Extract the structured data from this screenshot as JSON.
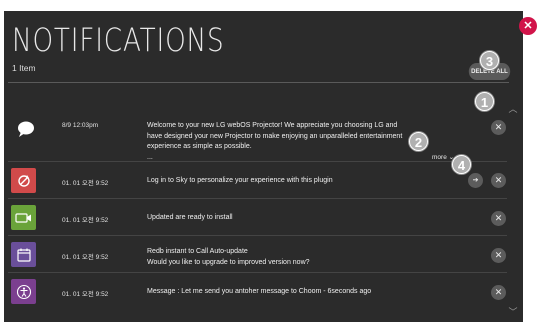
{
  "header": {
    "title": "NOTIFICATIONS",
    "count": "1 Item",
    "delete_all_label": "DELETE ALL"
  },
  "callouts": [
    "1",
    "2",
    "3",
    "4"
  ],
  "colors": {
    "panel_bg": "#2b2b2b",
    "close_accent": "#d1144a",
    "icon_red": "#d14a4a",
    "icon_green": "#6aa33a",
    "icon_purple_calendar": "#6a4f9a",
    "icon_purple_accessibility": "#7b3f8f"
  },
  "notifications": [
    {
      "timestamp": "8/9 12:03pm",
      "message_lines": [
        "Welcome to your new LG webOS Projector! We appreciate you choosing LG and",
        "have designed your new Projector to make enjoying an unparalleled entertainment",
        "experience as simple as possible.",
        "..."
      ],
      "more_label": "more",
      "icon": "speech-bubble-icon"
    },
    {
      "timestamp": "01. 01 오전 9:52",
      "message_lines": [
        "Log in to Sky to personalize your experience with this plugin"
      ],
      "icon": "sync-icon"
    },
    {
      "timestamp": "01. 01 오전 9:52",
      "message_lines": [
        "Updated are ready to install"
      ],
      "icon": "camera-icon"
    },
    {
      "timestamp": "01. 01 오전 9:52",
      "message_lines": [
        "Redb instant to Call Auto-update",
        "Would you like to upgrade to improved version now?"
      ],
      "icon": "calendar-icon"
    },
    {
      "timestamp": "01. 01 오전 9:52",
      "message_lines": [
        "Message : Let me send you antoher message to Choom - 6seconds ago"
      ],
      "icon": "accessibility-icon"
    }
  ]
}
